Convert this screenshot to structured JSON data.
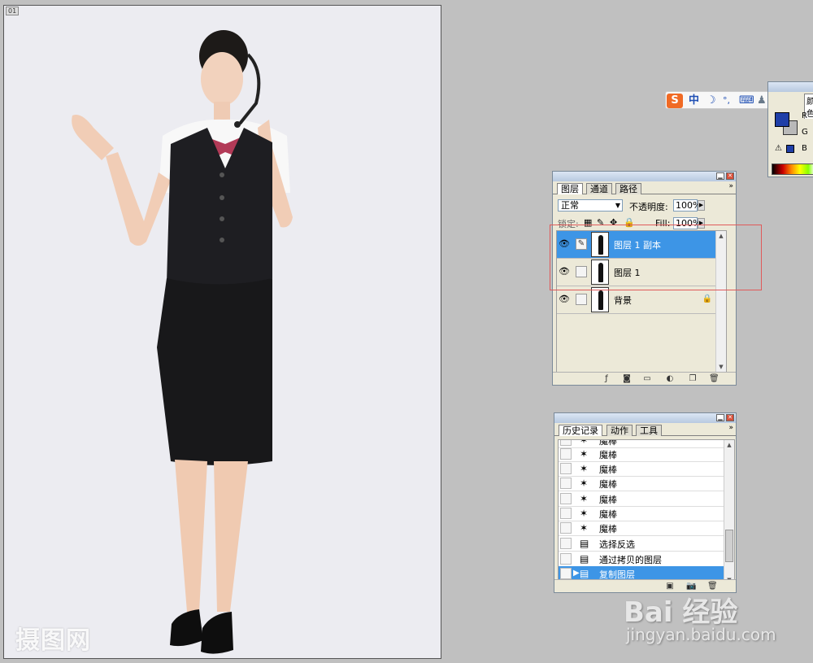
{
  "document": {
    "tag": "01",
    "watermark": "摄图网"
  },
  "layers_panel": {
    "tabs": [
      "图层",
      "通道",
      "路径"
    ],
    "blend_mode": "正常",
    "opacity_label": "不透明度:",
    "opacity_value": "100%",
    "lock_label": "锁定:",
    "fill_label": "Fill:",
    "fill_value": "100%",
    "layers": [
      {
        "name": "图层 1 副本",
        "selected": true
      },
      {
        "name": "图层 1",
        "selected": false
      },
      {
        "name": "背景",
        "selected": false
      }
    ]
  },
  "history_panel": {
    "tabs": [
      "历史记录",
      "动作",
      "工具"
    ],
    "items": [
      "魔棒",
      "魔棒",
      "魔棒",
      "魔棒",
      "魔棒",
      "魔棒",
      "魔棒",
      "选择反选",
      "通过拷贝的图层",
      "复制图层"
    ]
  },
  "ime_toolbar": {
    "items": [
      "S",
      "中",
      "☽",
      "°,",
      "⌨",
      "♟",
      "👕",
      "🔧"
    ]
  },
  "color_panel": {
    "tab": "颜色",
    "labels": [
      "R",
      "G",
      "B"
    ],
    "fg_color": "#1f3fa8",
    "bg_color": "#b9b9b9"
  },
  "baidu": {
    "logo": "Bai 经验",
    "url": "jingyan.baidu.com"
  },
  "colors": {
    "selection": "#3d95e6",
    "highlight_box": "#e05a5a"
  }
}
